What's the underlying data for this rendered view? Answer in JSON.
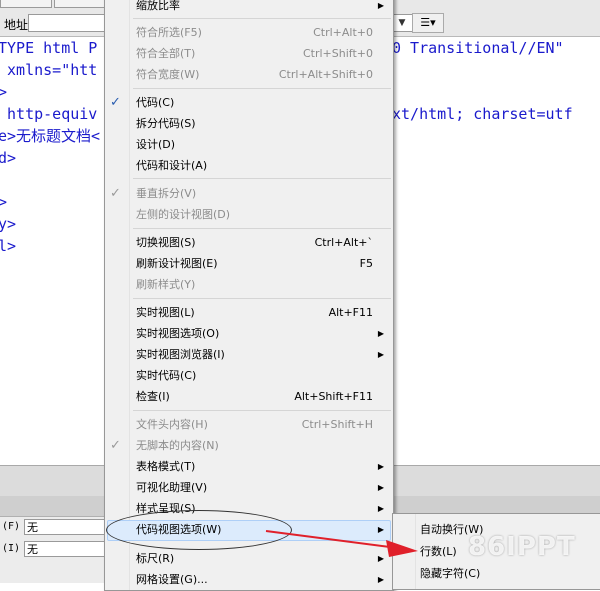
{
  "toolbar": {
    "address_label": "地址:"
  },
  "code_lines": [
    "TYPE html P",
    " xmlns=\"htt",
    ">",
    " http-equiv",
    "e>无标题文档<",
    "d>",
    "",
    ">",
    "y>",
    "l>"
  ],
  "code_right": [
    {
      "text": "0 Transitional//EN\""
    },
    {
      "text": "xt/html; charset=utf"
    }
  ],
  "menu": {
    "items": [
      {
        "label": "缩放比率",
        "shortcut": "",
        "arrow": true,
        "disabled": false,
        "checked": false
      },
      {
        "label": "符合所选(F5)",
        "shortcut": "Ctrl+Alt+0",
        "arrow": false,
        "disabled": true,
        "checked": false
      },
      {
        "label": "符合全部(T)",
        "shortcut": "Ctrl+Shift+0",
        "arrow": false,
        "disabled": true,
        "checked": false
      },
      {
        "label": "符合宽度(W)",
        "shortcut": "Ctrl+Alt+Shift+0",
        "arrow": false,
        "disabled": true,
        "checked": false
      },
      {
        "label": "代码(C)",
        "shortcut": "",
        "arrow": false,
        "disabled": false,
        "checked": true
      },
      {
        "label": "拆分代码(S)",
        "shortcut": "",
        "arrow": false,
        "disabled": false,
        "checked": false
      },
      {
        "label": "设计(D)",
        "shortcut": "",
        "arrow": false,
        "disabled": false,
        "checked": false
      },
      {
        "label": "代码和设计(A)",
        "shortcut": "",
        "arrow": false,
        "disabled": false,
        "checked": false
      },
      {
        "label": "垂直拆分(V)",
        "shortcut": "",
        "arrow": false,
        "disabled": true,
        "checked": true
      },
      {
        "label": "左侧的设计视图(D)",
        "shortcut": "",
        "arrow": false,
        "disabled": true,
        "checked": false
      },
      {
        "label": "切换视图(S)",
        "shortcut": "Ctrl+Alt+`",
        "arrow": false,
        "disabled": false,
        "checked": false
      },
      {
        "label": "刷新设计视图(E)",
        "shortcut": "F5",
        "arrow": false,
        "disabled": false,
        "checked": false
      },
      {
        "label": "刷新样式(Y)",
        "shortcut": "",
        "arrow": false,
        "disabled": true,
        "checked": false
      },
      {
        "label": "实时视图(L)",
        "shortcut": "Alt+F11",
        "arrow": false,
        "disabled": false,
        "checked": false
      },
      {
        "label": "实时视图选项(O)",
        "shortcut": "",
        "arrow": true,
        "disabled": false,
        "checked": false
      },
      {
        "label": "实时视图浏览器(I)",
        "shortcut": "",
        "arrow": true,
        "disabled": false,
        "checked": false
      },
      {
        "label": "实时代码(C)",
        "shortcut": "",
        "arrow": false,
        "disabled": false,
        "checked": false
      },
      {
        "label": "检查(I)",
        "shortcut": "Alt+Shift+F11",
        "arrow": false,
        "disabled": false,
        "checked": false
      },
      {
        "label": "文件头内容(H)",
        "shortcut": "Ctrl+Shift+H",
        "arrow": false,
        "disabled": true,
        "checked": false
      },
      {
        "label": "无脚本的内容(N)",
        "shortcut": "",
        "arrow": false,
        "disabled": true,
        "checked": true
      },
      {
        "label": "表格模式(T)",
        "shortcut": "",
        "arrow": true,
        "disabled": false,
        "checked": false
      },
      {
        "label": "可视化助理(V)",
        "shortcut": "",
        "arrow": true,
        "disabled": false,
        "checked": false
      },
      {
        "label": "样式呈现(S)",
        "shortcut": "",
        "arrow": true,
        "disabled": false,
        "checked": false
      },
      {
        "label": "代码视图选项(W)",
        "shortcut": "",
        "arrow": true,
        "disabled": false,
        "checked": false,
        "highlighted": true
      },
      {
        "label": "标尺(R)",
        "shortcut": "",
        "arrow": true,
        "disabled": false,
        "checked": false
      },
      {
        "label": "网格设置(G)...",
        "shortcut": "",
        "arrow": true,
        "disabled": false,
        "checked": false
      }
    ]
  },
  "submenu": {
    "items": [
      {
        "label": "自动换行(W)"
      },
      {
        "label": "行数(L)"
      },
      {
        "label": "隐藏字符(C)"
      }
    ]
  },
  "properties": {
    "row1_label": "(F)",
    "row1_value": "无",
    "row2_label": "(I)",
    "row2_value": "无"
  },
  "watermark": "86IPPT"
}
